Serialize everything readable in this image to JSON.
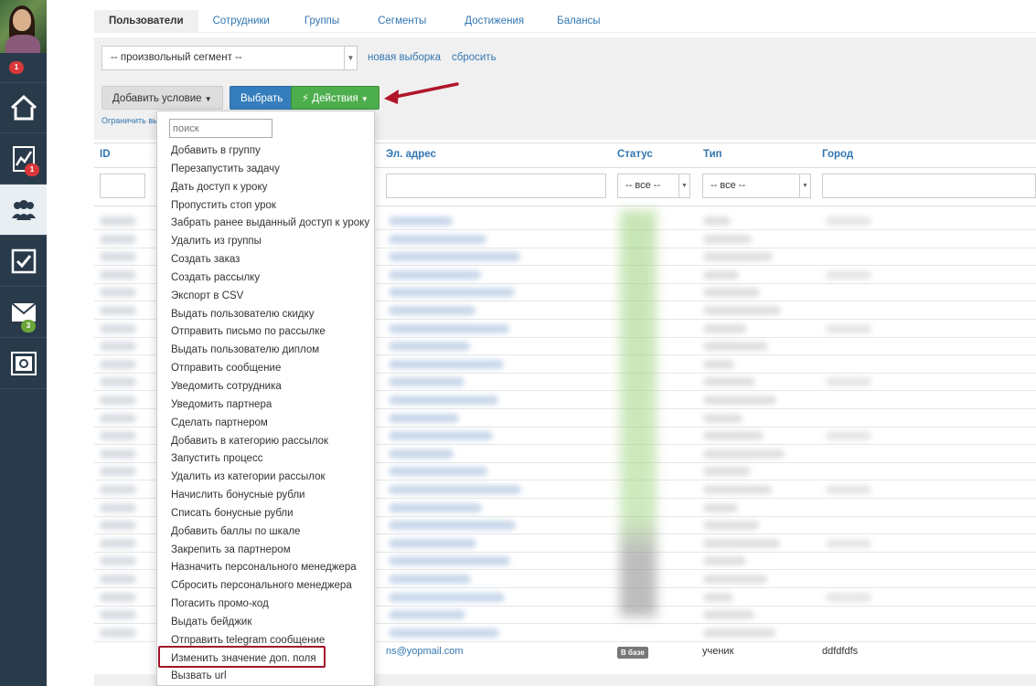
{
  "sidebar": {
    "avatar_badge": "1",
    "items": [
      {
        "icon": "home-icon",
        "badge": ""
      },
      {
        "icon": "chart-icon",
        "badge": "1"
      },
      {
        "icon": "users-icon",
        "badge": "",
        "active": true
      },
      {
        "icon": "checkbox-icon",
        "badge": ""
      },
      {
        "icon": "mail-icon",
        "badge": "3"
      },
      {
        "icon": "safe-icon",
        "badge": ""
      }
    ]
  },
  "tabs": [
    {
      "label": "Пользователи",
      "active": true
    },
    {
      "label": "Сотрудники"
    },
    {
      "label": "Группы"
    },
    {
      "label": "Сегменты"
    },
    {
      "label": "Достижения"
    },
    {
      "label": "Балансы"
    }
  ],
  "filter": {
    "segment_value": "-- произвольный сегмент --",
    "new_selection": "новая выборка",
    "reset": "сбросить",
    "add_condition": "Добавить условие",
    "select": "Выбрать",
    "actions": "Действия",
    "restrict": "Ограничить вы"
  },
  "table": {
    "headers": {
      "id": "ID",
      "email": "Эл. адрес",
      "status": "Статус",
      "type": "Тип",
      "city": "Город"
    },
    "status_filter": "-- все --",
    "type_filter": "-- все --",
    "visible_row": {
      "email": "ns@yopmail.com",
      "status": "В базе",
      "type": "ученик",
      "city": "ddfdfdfs"
    }
  },
  "dropdown": {
    "search_placeholder": "поиск",
    "items": [
      "Добавить в группу",
      "Перезапустить задачу",
      "Дать доступ к уроку",
      "Пропустить стоп урок",
      "Забрать ранее выданный доступ к уроку",
      "Удалить из группы",
      "Создать заказ",
      "Создать рассылку",
      "Экспорт в CSV",
      "Выдать пользователю скидку",
      "Отправить письмо по рассылке",
      "Выдать пользователю диплом",
      "Отправить сообщение",
      "Уведомить сотрудника",
      "Уведомить партнера",
      "Сделать партнером",
      "Добавить в категорию рассылок",
      "Запустить процесс",
      "Удалить из категории рассылок",
      "Начислить бонусные рубли",
      "Списать бонусные рубли",
      "Добавить баллы по шкале",
      "Закрепить за партнером",
      "Назначить персонального менеджера",
      "Сбросить персонального менеджера",
      "Погасить промо-код",
      "Выдать бейджик",
      "Отправить telegram сообщение",
      "Изменить значение доп. поля",
      "Вызвать url"
    ],
    "highlighted_item": "Изменить значение доп. поля"
  },
  "colors": {
    "sidebar": "#293a4a",
    "link": "#3276b1",
    "primary": "#357ebd",
    "success": "#4cae4c",
    "badge_red": "#d9383a",
    "badge_green": "#6ba539",
    "highlight": "#a3132a"
  }
}
